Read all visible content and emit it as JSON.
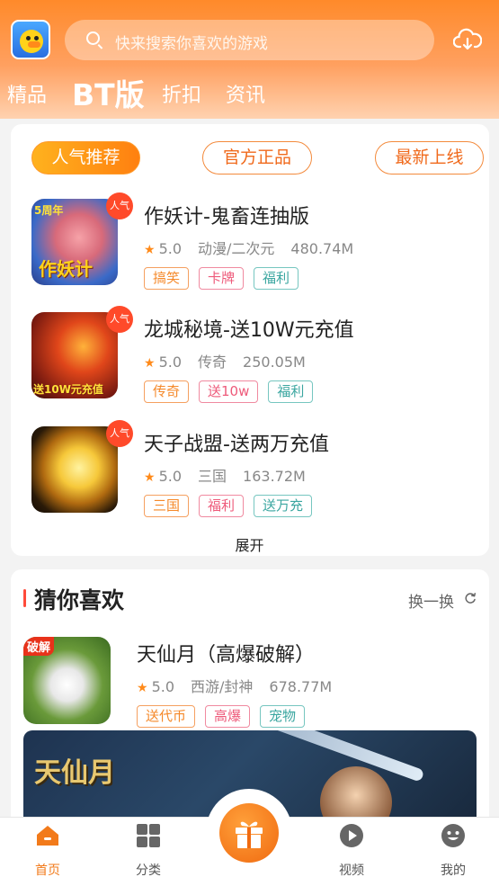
{
  "header": {
    "search_placeholder": "快来搜索你喜欢的游戏",
    "tabs": [
      "精品",
      "BT版",
      "折扣",
      "资讯"
    ],
    "active_tab": "BT版"
  },
  "ranking": {
    "filters": [
      "人气推荐",
      "官方正品",
      "最新上线"
    ],
    "active_filter": "人气推荐",
    "badge": "人气",
    "games": [
      {
        "name": "作妖计-鬼畜连抽版",
        "rating": "5.0",
        "genre": "动漫/二次元",
        "size": "480.74M",
        "tags": [
          "搞笑",
          "卡牌",
          "福利"
        ],
        "thumb_text": "作妖计",
        "thumb_corner": "5周年"
      },
      {
        "name": "龙城秘境-送10W元充值",
        "rating": "5.0",
        "genre": "传奇",
        "size": "250.05M",
        "tags": [
          "传奇",
          "送10w",
          "福利"
        ],
        "thumb_text": "送10W元充值"
      },
      {
        "name": "天子战盟-送两万充值",
        "rating": "5.0",
        "genre": "三国",
        "size": "163.72M",
        "tags": [
          "三国",
          "福利",
          "送万充"
        ]
      }
    ],
    "expand_label": "展开"
  },
  "guess": {
    "title": "猜你喜欢",
    "refresh_label": "换一换",
    "games": [
      {
        "name": "天仙月（高爆破解）",
        "rating": "5.0",
        "genre": "西游/封神",
        "size": "678.77M",
        "tags": [
          "送代币",
          "高爆",
          "宠物"
        ],
        "thumb_corner": "破解"
      }
    ],
    "banner_text": "天仙月"
  },
  "bottom_nav": {
    "items": [
      {
        "label": "首页",
        "icon": "home-icon",
        "active": true
      },
      {
        "label": "分类",
        "icon": "grid-icon",
        "active": false
      },
      {
        "label": "",
        "icon": "gift-icon",
        "active": false
      },
      {
        "label": "视频",
        "icon": "play-icon",
        "active": false
      },
      {
        "label": "我的",
        "icon": "smiley-icon",
        "active": false
      }
    ]
  },
  "colors": {
    "accent": "#f27a1a",
    "header_top": "#ff8a2a",
    "hot_badge": "#ff4a2a"
  }
}
